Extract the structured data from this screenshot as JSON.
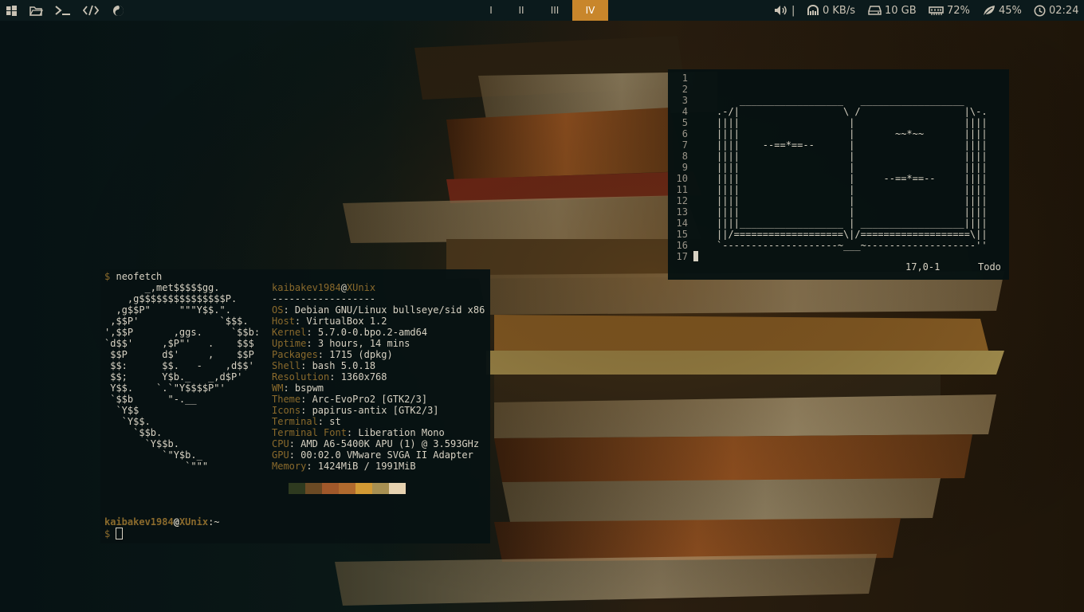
{
  "topbar": {
    "launchers": [
      {
        "icon": "windows-icon"
      },
      {
        "icon": "folder-icon"
      },
      {
        "icon": "terminal-icon"
      },
      {
        "icon": "code-icon"
      },
      {
        "icon": "browser-icon"
      }
    ],
    "workspaces": [
      {
        "label": "I",
        "active": false
      },
      {
        "label": "II",
        "active": false
      },
      {
        "label": "III",
        "active": false
      },
      {
        "label": "IV",
        "active": true
      }
    ],
    "status": {
      "volume_sep": "|",
      "network": "0 KB/s",
      "disk": "10 GB",
      "memory": "72%",
      "battery": "45%",
      "clock": "02:24"
    },
    "accent": "#c8862b"
  },
  "terminal": {
    "command_prompt": "$",
    "command": "neofetch",
    "user": "kaibakev1984",
    "at": "@",
    "host": "XUnix",
    "separator": "------------------",
    "logo_lines": [
      "       _,met$$$$$gg.",
      "    ,g$$$$$$$$$$$$$$$P.",
      "  ,g$$P\"     \"\"\"Y$$.\".",
      " ,$$P'              `$$$.",
      "',$$P       ,ggs.     `$$b:",
      "`d$$'     ,$P\"'   .    $$$",
      " $$P      d$'     ,    $$P",
      " $$:      $$.   -    ,d$$'",
      " $$;      Y$b._   _,d$P'",
      " Y$$.    `.`\"Y$$$$P\"'",
      " `$$b      \"-.__",
      "  `Y$$",
      "   `Y$$.",
      "     `$$b.",
      "       `Y$$b.",
      "          `\"Y$b._",
      "              `\"\"\""
    ],
    "info": [
      {
        "label": "OS",
        "value": "Debian GNU/Linux bullseye/sid x86"
      },
      {
        "label": "Host",
        "value": "VirtualBox 1.2"
      },
      {
        "label": "Kernel",
        "value": "5.7.0-0.bpo.2-amd64"
      },
      {
        "label": "Uptime",
        "value": "3 hours, 14 mins"
      },
      {
        "label": "Packages",
        "value": "1715 (dpkg)"
      },
      {
        "label": "Shell",
        "value": "bash 5.0.18"
      },
      {
        "label": "Resolution",
        "value": "1360x768"
      },
      {
        "label": "WM",
        "value": "bspwm"
      },
      {
        "label": "Theme",
        "value": "Arc-EvoPro2 [GTK2/3]"
      },
      {
        "label": "Icons",
        "value": "papirus-antix [GTK2/3]"
      },
      {
        "label": "Terminal",
        "value": "st"
      },
      {
        "label": "Terminal Font",
        "value": "Liberation Mono"
      },
      {
        "label": "CPU",
        "value": "AMD A6-5400K APU (1) @ 3.593GHz"
      },
      {
        "label": "GPU",
        "value": "00:02.0 VMware SVGA II Adapter"
      },
      {
        "label": "Memory",
        "value": "1424MiB / 1991MiB"
      }
    ],
    "colors": [
      "#2e3a1f",
      "#6b4a24",
      "#a0582a",
      "#b06a2e",
      "#d29a34",
      "#a89052",
      "#e6d2b0"
    ],
    "prompt_user": "kaibakev1984",
    "prompt_at": "@",
    "prompt_host": "XUnix",
    "prompt_path": ":~",
    "prompt_sign": "$"
  },
  "vim": {
    "line_numbers": [
      "1",
      "2",
      "3",
      "4",
      "5",
      "6",
      "7",
      "8",
      "9",
      "10",
      "11",
      "12",
      "13",
      "14",
      "15",
      "16",
      "17"
    ],
    "art_lines": [
      "",
      "    __________________   __________________",
      ".-/|                  \\ /                  |\\-.",
      "||||                   |                   ||||",
      "||||                   |       ~~*~~       ||||",
      "||||    --==*==--      |                   ||||",
      "||||                   |                   ||||",
      "||||                   |                   ||||",
      "||||                   |     --==*==--     ||||",
      "||||                   |                   ||||",
      "||||                   |                   ||||",
      "||||                   |                   ||||",
      "||||__________________ | __________________||||",
      "||/===================\\|/===================\\||",
      "`--------------------~___~-------------------''",
      ""
    ],
    "position": "17,0-1",
    "scroll": "Todo"
  }
}
